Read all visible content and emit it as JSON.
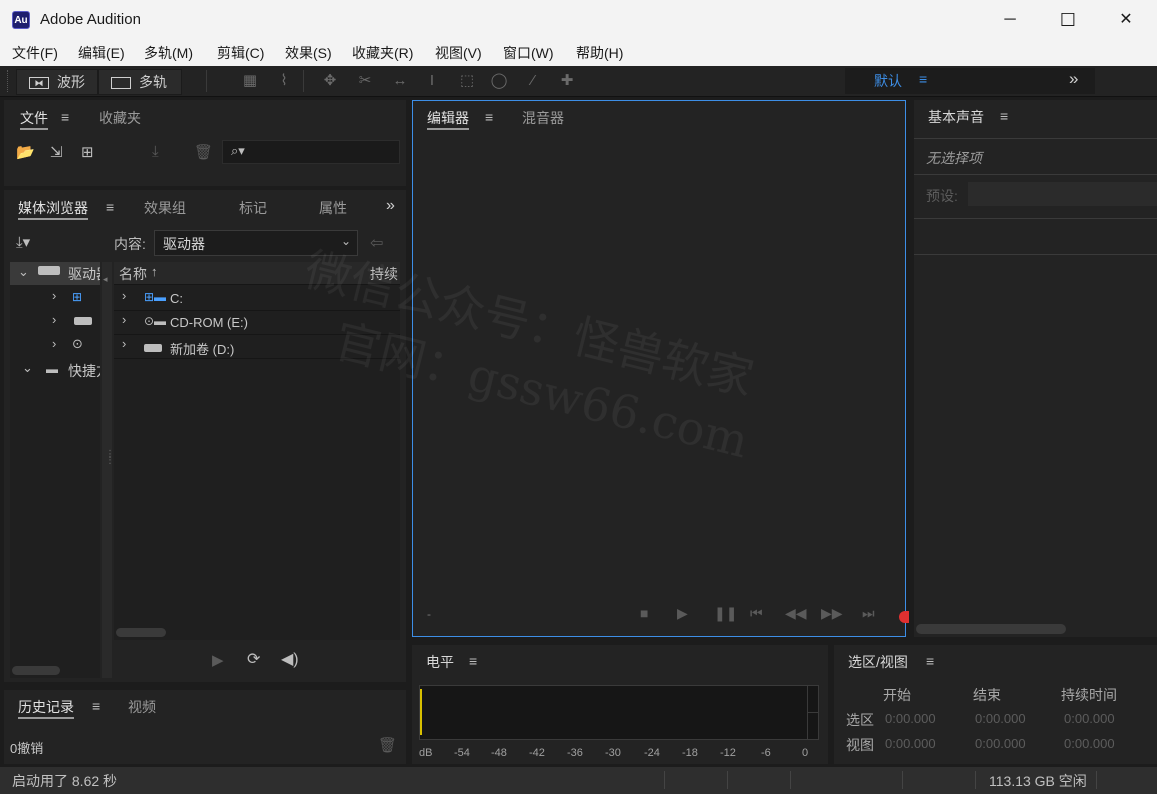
{
  "window": {
    "title": "Adobe Audition",
    "logo": "Au"
  },
  "window_controls": [
    "─",
    "☐",
    "✕"
  ],
  "menu": [
    "文件(F)",
    "编辑(E)",
    "多轨(M)",
    "剪辑(C)",
    "效果(S)",
    "收藏夹(R)",
    "视图(V)",
    "窗口(W)",
    "帮助(H)"
  ],
  "toolbar": {
    "waveform_label": "波形",
    "multitrack_label": "多轨",
    "workspace_label": "默认",
    "more": "»"
  },
  "files_panel": {
    "tabs": [
      "文件",
      "收藏夹"
    ]
  },
  "media_panel": {
    "tabs": [
      "媒体浏览器",
      "效果组",
      "标记",
      "属性"
    ],
    "content_label": "内容:",
    "content_value": "驱动器",
    "tree": {
      "root": "驱动器",
      "shortcuts": "快捷方式"
    },
    "columns": {
      "name": "名称",
      "duration": "持续"
    },
    "drives": [
      "C:",
      "CD-ROM (E:)",
      "新加卷 (D:)"
    ]
  },
  "history_panel": {
    "tabs": [
      "历史记录",
      "视频"
    ],
    "undo_text": "0撤销"
  },
  "editor_panel": {
    "tabs": [
      "编辑器",
      "混音器"
    ],
    "time": "-"
  },
  "sound_panel": {
    "title": "基本声音",
    "no_selection": "无选择项",
    "preset_label": "预设:"
  },
  "level_panel": {
    "title": "电平",
    "scale": [
      "dB",
      "-54",
      "-48",
      "-42",
      "-36",
      "-30",
      "-24",
      "-18",
      "-12",
      "-6",
      "0"
    ]
  },
  "selection_panel": {
    "title": "选区/视图",
    "headers": [
      "开始",
      "结束",
      "持续时间"
    ],
    "rows": [
      {
        "label": "选区",
        "start": "0:00.000",
        "end": "0:00.000",
        "duration": "0:00.000"
      },
      {
        "label": "视图",
        "start": "0:00.000",
        "end": "0:00.000",
        "duration": "0:00.000"
      }
    ]
  },
  "status": {
    "startup": "启动用了 8.62 秒",
    "disk": "113.13 GB 空闲"
  },
  "watermark": {
    "line1": "微信公众号：怪兽软家",
    "line2": "官网：gssw66.com"
  },
  "colors": {
    "accent": "#3d8ee6",
    "panel": "#232323",
    "record": "#e03030"
  }
}
